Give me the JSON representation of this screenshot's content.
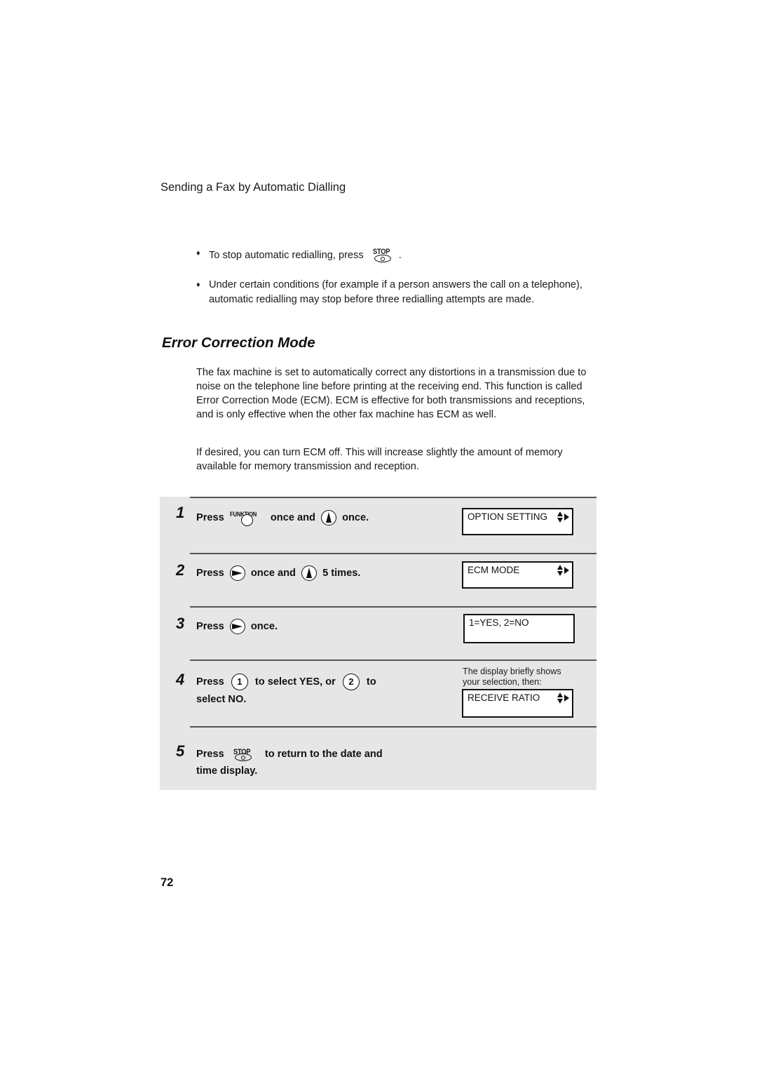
{
  "header": {
    "running_title": "Sending a Fax by Automatic Dialling"
  },
  "bullets": [
    {
      "icon": "diamond-bullet",
      "text_before": "To stop automatic redialling, press",
      "button_icon": "stop-key-icon",
      "button_label": "STOP",
      "text_after": "."
    },
    {
      "icon": "diamond-bullet",
      "text": "Under certain conditions (for example if a person answers the call on a telephone), automatic redialling may stop before three redialling attempts are made."
    }
  ],
  "section": {
    "title": "Error Correction Mode",
    "paragraphs": [
      "The fax machine is set to automatically correct any distortions in a transmission due to noise on the telephone line before printing at the receiving end. This function is called Error Correction Mode (ECM). ECM is effective for both transmissions and receptions, and is only effective when the other fax machine has ECM as well.",
      "If desired, you can turn ECM off. This will increase slightly the amount of memory available for memory transmission and reception."
    ]
  },
  "steps": [
    {
      "number": "1",
      "press": "Press",
      "key1_label": "FUNKTION",
      "mid": "once and",
      "key2_icon": "up-arrow-key-icon",
      "end": "once.",
      "display": "OPTION SETTING",
      "display_arrows": true
    },
    {
      "number": "2",
      "press": "Press",
      "key1_icon": "right-arrow-key-icon",
      "mid": "once and",
      "key2_icon": "up-arrow-key-icon",
      "end": "5 times.",
      "display": "ECM MODE",
      "display_arrows": true
    },
    {
      "number": "3",
      "press": "Press",
      "key1_icon": "right-arrow-key-icon",
      "end": "once.",
      "display": "1=YES, 2=NO",
      "display_arrows": false
    },
    {
      "number": "4",
      "press": "Press",
      "key1_label": "1",
      "mid": "to select YES, or",
      "key2_label": "2",
      "end": "to",
      "line2": "select NO.",
      "note_line1": "The display briefly shows",
      "note_line2": "your selection, then:",
      "display": "RECEIVE RATIO",
      "display_arrows": true
    },
    {
      "number": "5",
      "press": "Press",
      "key1_label": "STOP",
      "mid": "to return to the date and",
      "line2": "time display."
    }
  ],
  "footer": {
    "page_number": "72"
  },
  "colors": {
    "panel_background": "#e6e6e6",
    "divider": "#555555",
    "text": "#111111"
  }
}
